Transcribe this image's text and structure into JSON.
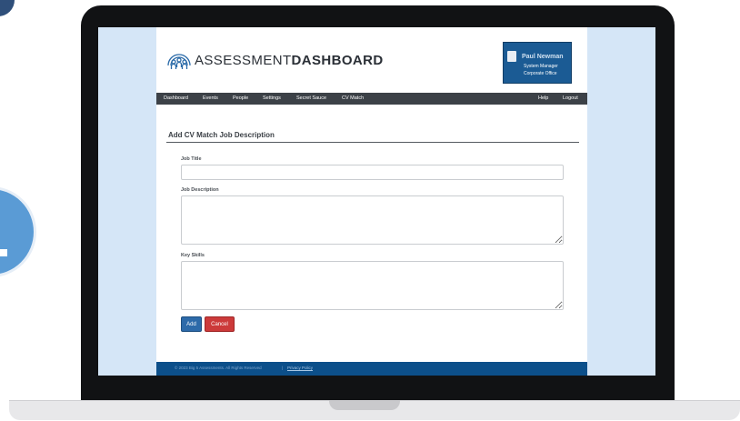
{
  "app": {
    "logo_thin": "ASSESSMENT",
    "logo_bold": "DASHBOARD"
  },
  "user": {
    "name": "Paul Newman",
    "role": "System Manager",
    "office": "Corporate Office"
  },
  "nav": {
    "items": [
      "Dashboard",
      "Events",
      "People",
      "Settings",
      "Secret Sauce",
      "CV Match"
    ],
    "right": [
      "Help",
      "Logout"
    ]
  },
  "form": {
    "title": "Add CV Match Job Description",
    "job_title_label": "Job Title",
    "job_title_value": "",
    "job_description_label": "Job Description",
    "job_description_value": "",
    "key_skills_label": "Key Skills",
    "key_skills_value": "",
    "add_label": "Add",
    "cancel_label": "Cancel"
  },
  "footer": {
    "copyright": "© 2023 Big 5 Assessments. All Rights Reserved",
    "separator": "|",
    "privacy_link": "Privacy Policy"
  },
  "colors": {
    "nav_bg": "#3c4147",
    "user_box": "#1b5b94",
    "footer_bg": "#0c4f8a",
    "screen_bg": "#d5e6f7",
    "add_button": "#2d6aa9",
    "cancel_button": "#cc3a3a"
  }
}
